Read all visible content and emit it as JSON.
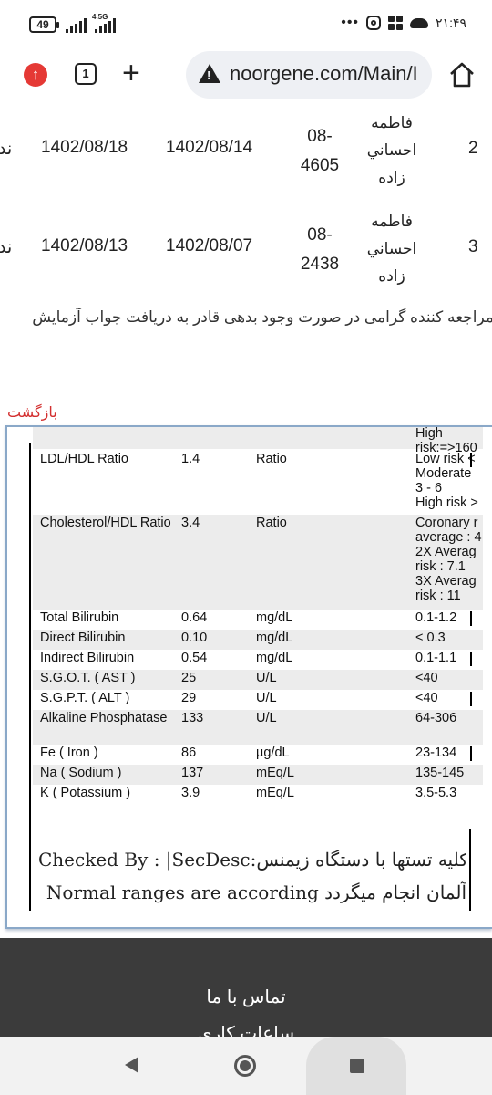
{
  "status_bar": {
    "battery": "49",
    "network_label": "4.5G",
    "menu_dots": "•••",
    "time": "۲۱:۴۹"
  },
  "browser": {
    "update_icon": "arrow-up-icon",
    "tab_count": "1",
    "new_tab_icon": "+",
    "url": "noorgene.com/Main/I",
    "home_icon": "home-icon"
  },
  "results_table": {
    "rows": [
      {
        "index": "2",
        "name_line1": "فاطمه",
        "name_line2": "احساني",
        "name_line3": "زاده",
        "code_line1": "08-",
        "code_line2": "4605",
        "date_received": "1402/08/14",
        "date_ready": "1402/08/18",
        "status_fragment": "ند"
      },
      {
        "index": "3",
        "name_line1": "فاطمه",
        "name_line2": "احساني",
        "name_line3": "زاده",
        "code_line1": "08-",
        "code_line2": "2438",
        "date_received": "1402/08/07",
        "date_ready": "1402/08/13",
        "status_fragment": "ند"
      }
    ]
  },
  "notice": "مراجعه کننده گرامی در صورت وجود بدهی قادر به دریافت جواب آزمایش",
  "back_link": "بازگشت",
  "lab_report": {
    "rows": [
      {
        "name": "",
        "value": "",
        "unit": "",
        "ref": "High\nrisk:=>160",
        "shade": true
      },
      {
        "name": "LDL/HDL Ratio",
        "value": "1.4",
        "unit": "Ratio",
        "ref": "Low risk <\nModerate\n3 - 6\nHigh risk >",
        "shade": false
      },
      {
        "name": "Cholesterol/HDL Ratio",
        "value": "3.4",
        "unit": "Ratio",
        "ref": "Coronary r\naverage : 4\n2X Averag\nrisk : 7.1\n3X Averag\nrisk : 11",
        "shade": true
      },
      {
        "name": "Total Bilirubin",
        "value": "0.64",
        "unit": "mg/dL",
        "ref": "0.1-1.2",
        "shade": false
      },
      {
        "name": "Direct Bilirubin",
        "value": "0.10",
        "unit": "mg/dL",
        "ref": "< 0.3",
        "shade": true
      },
      {
        "name": "Indirect Bilirubin",
        "value": "0.54",
        "unit": "mg/dL",
        "ref": "0.1-1.1",
        "shade": false
      },
      {
        "name": "S.G.O.T. ( AST )",
        "value": "25",
        "unit": "U/L",
        "ref": "<40",
        "shade": true
      },
      {
        "name": "S.G.P.T. ( ALT )",
        "value": "29",
        "unit": "U/L",
        "ref": "<40",
        "shade": false
      },
      {
        "name": "Alkaline Phosphatase",
        "value": "133",
        "unit": "U/L",
        "ref": "64-306",
        "shade": true
      },
      {
        "name": "Fe ( Iron )",
        "value": "86",
        "unit": "µg/dL",
        "ref": "23-134",
        "shade": false
      },
      {
        "name": "Na ( Sodium )",
        "value": "137",
        "unit": "mEq/L",
        "ref": "135-145",
        "shade": true
      },
      {
        "name": "K ( Potassium )",
        "value": "3.9",
        "unit": "mEq/L",
        "ref": "3.5-5.3",
        "shade": false
      }
    ],
    "checked_by_line": "Checked By : |SecDesc:کلیه تستها با دستگاه زیمنس",
    "normal_ranges_line": "آلمان انجام میگردد Normal ranges are according"
  },
  "site_footer": {
    "contact_title": "تماس با ما",
    "hours_label": "ساعات کاری"
  }
}
